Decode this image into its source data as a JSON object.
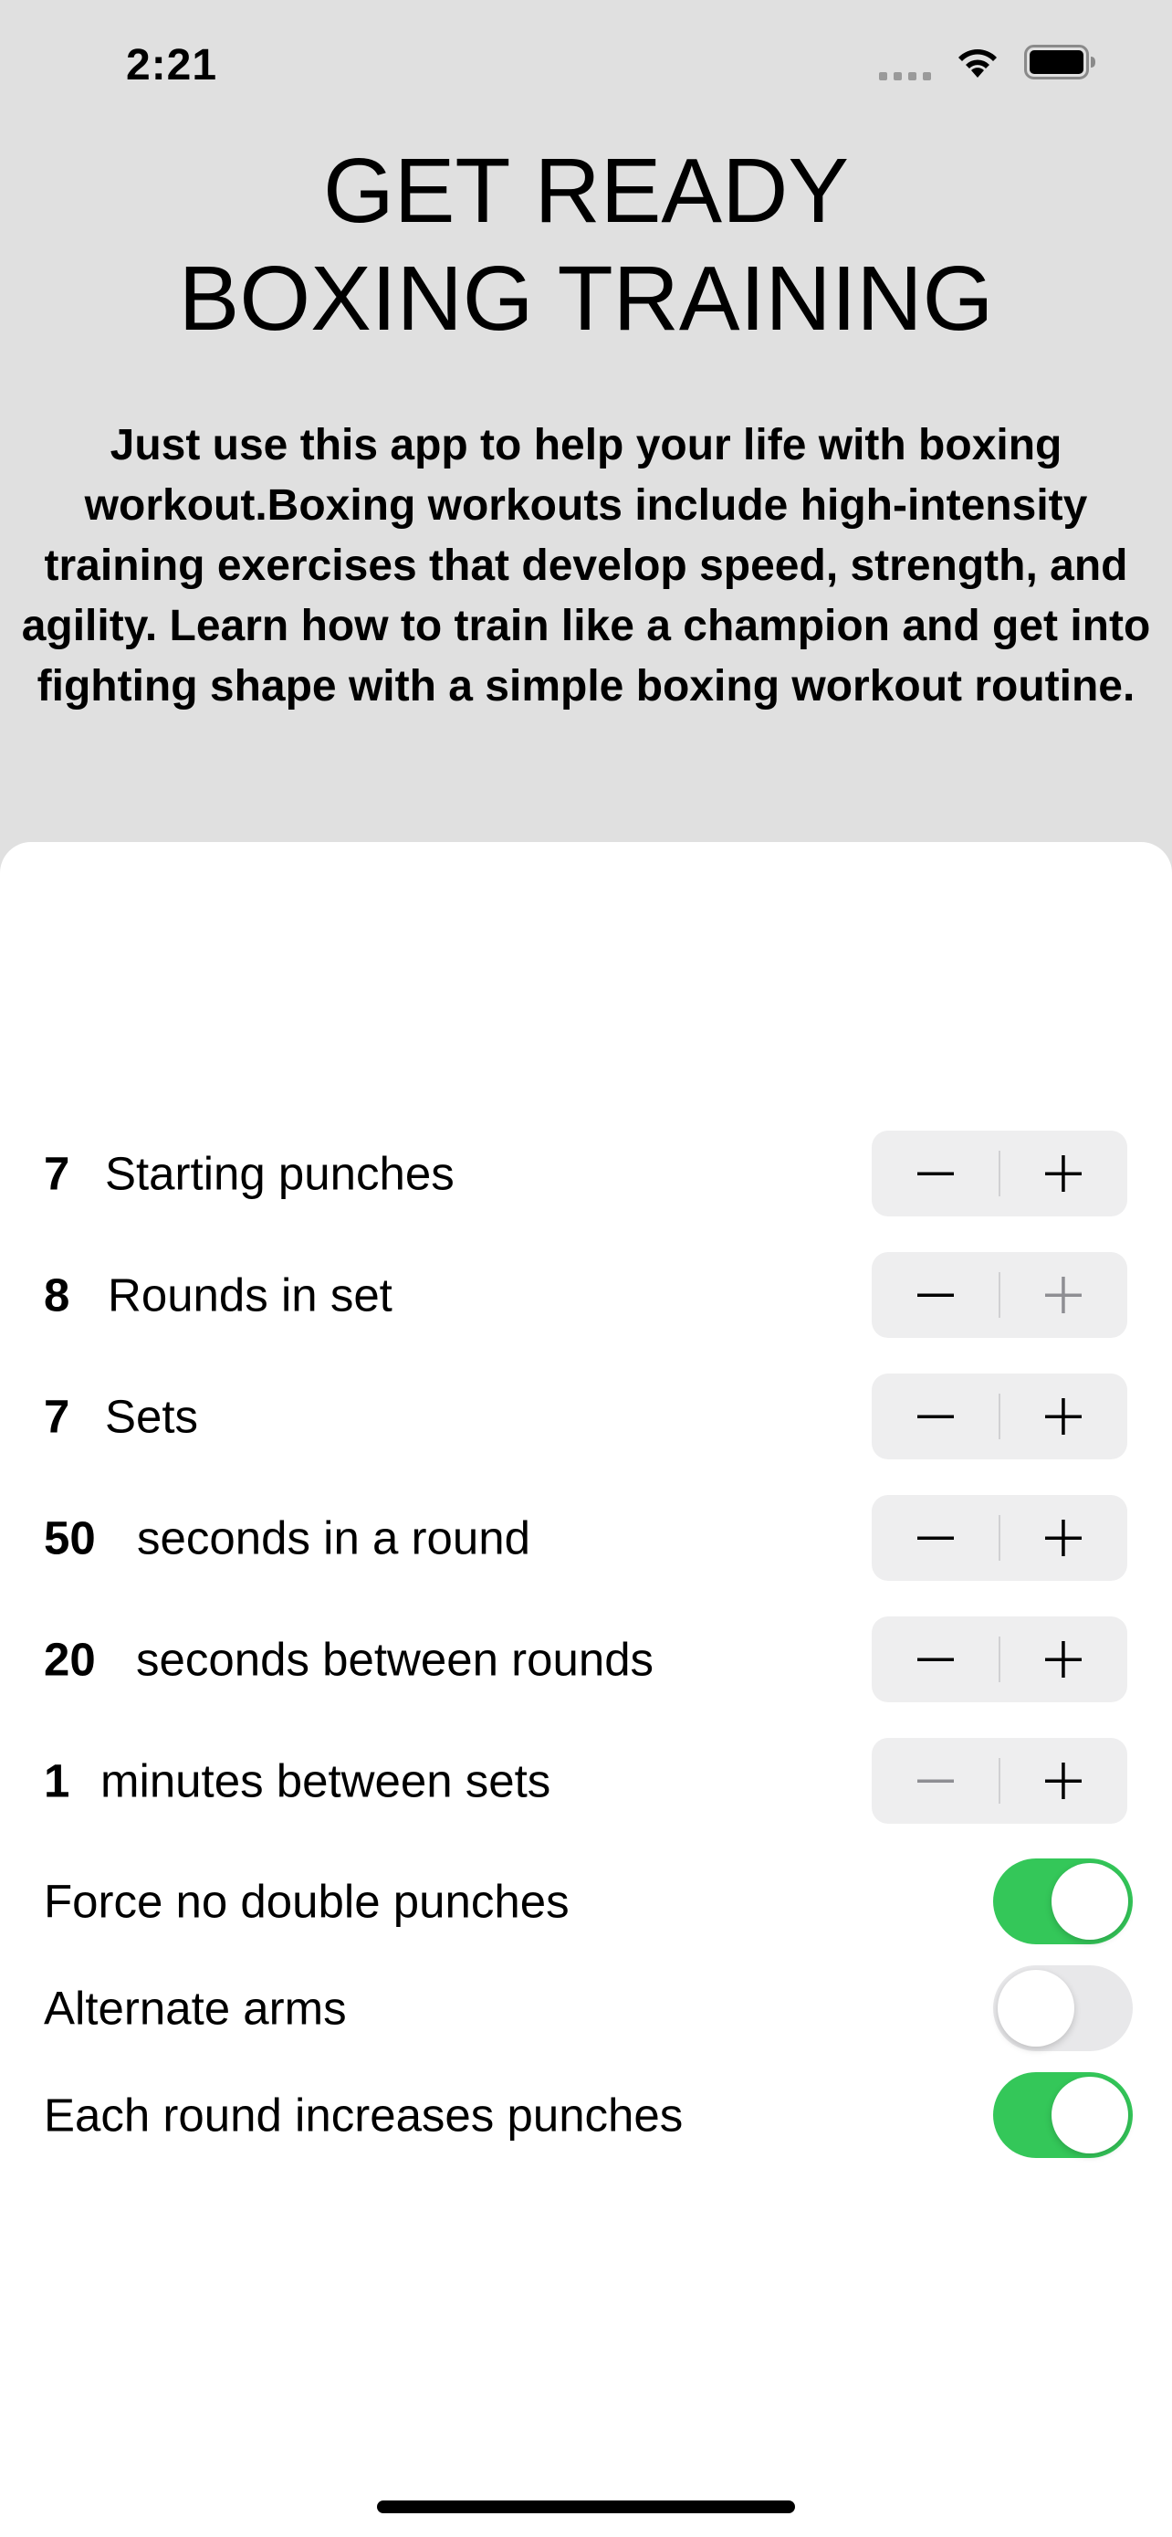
{
  "status_bar": {
    "time": "2:21"
  },
  "header": {
    "title_line1": "GET READY",
    "title_line2": "BOXING TRAINING",
    "description_lines": [
      "Just use this app to help your life with boxing",
      "workout.Boxing workouts include high-intensity",
      "training exercises that develop speed, strength, and",
      "agility. Learn how to train like a champion and get into",
      "fighting shape with a simple boxing workout routine."
    ]
  },
  "settings": {
    "steppers": [
      {
        "value": "7",
        "label": "Starting punches",
        "minus_enabled": true,
        "plus_enabled": true
      },
      {
        "value": "8",
        "label": "Rounds in set",
        "minus_enabled": true,
        "plus_enabled": false
      },
      {
        "value": "7",
        "label": "Sets",
        "minus_enabled": true,
        "plus_enabled": true
      },
      {
        "value": "50",
        "label": "seconds in a round",
        "minus_enabled": true,
        "plus_enabled": true
      },
      {
        "value": "20",
        "label": "seconds between rounds",
        "minus_enabled": true,
        "plus_enabled": true
      },
      {
        "value": "1",
        "label": "minutes between sets",
        "minus_enabled": false,
        "plus_enabled": true
      }
    ],
    "toggles": [
      {
        "label": "Force no double punches",
        "on": true
      },
      {
        "label": "Alternate arms",
        "on": false
      },
      {
        "label": "Each round increases punches",
        "on": true
      }
    ]
  },
  "colors": {
    "toggle_on": "#34c759",
    "toggle_off": "#e8e8ea",
    "header_bg": "#e0e0e0",
    "stepper_bg": "#eeeeef"
  }
}
